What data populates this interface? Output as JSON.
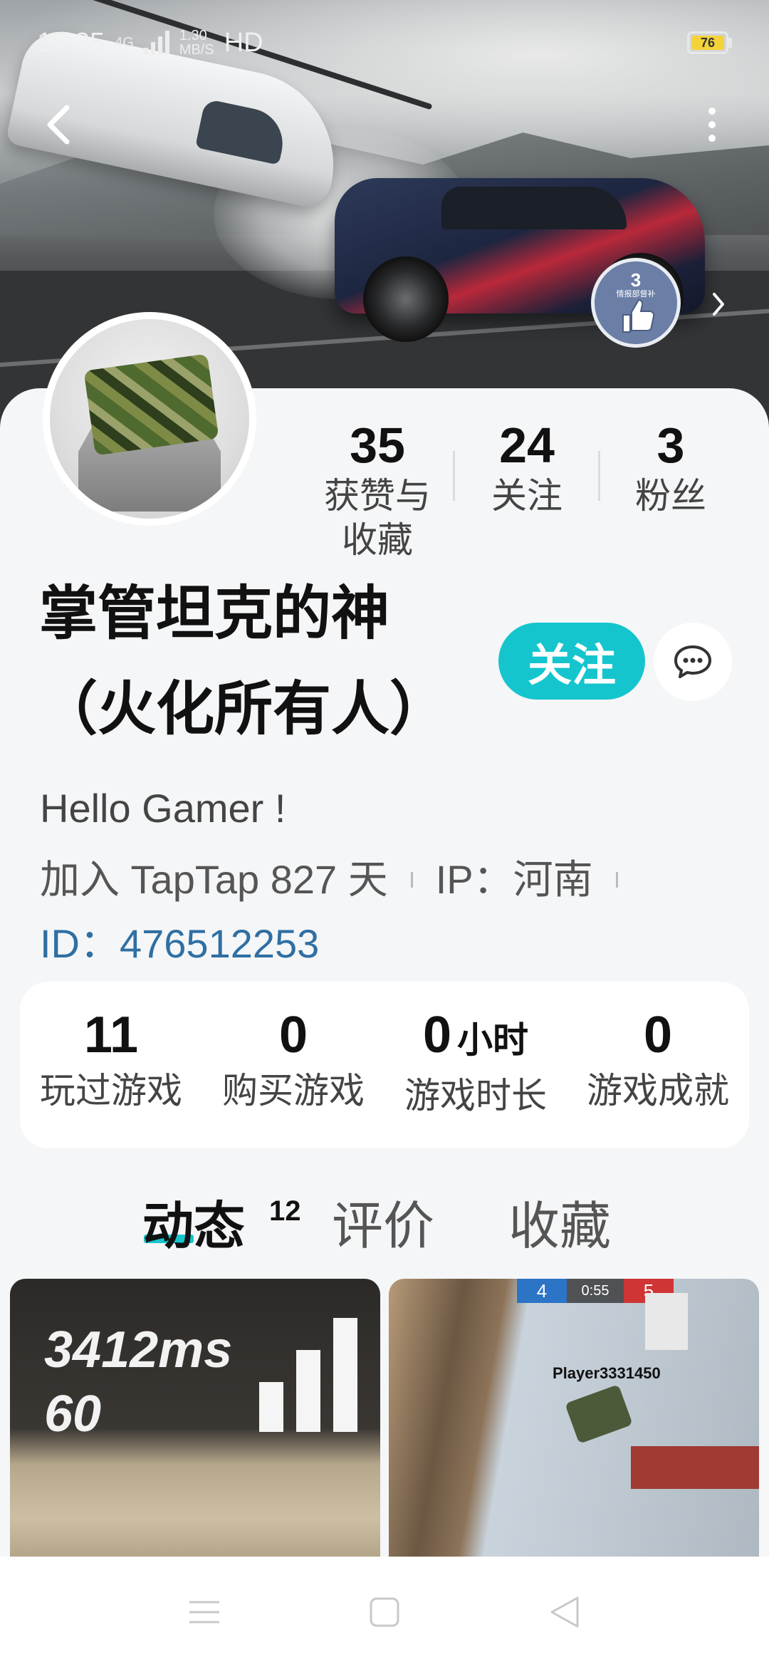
{
  "status_bar": {
    "time": "15:25",
    "network": "4G",
    "speed_value": "1.30",
    "speed_unit": "MB/S",
    "hd": "HD",
    "battery": "76"
  },
  "header": {
    "back_icon": "chevron-left-icon",
    "more_icon": "more-vertical-icon",
    "badge_count": "3",
    "badge_label": "情报部督补"
  },
  "profile": {
    "stats": [
      {
        "value": "35",
        "label": "获赞与收藏"
      },
      {
        "value": "24",
        "label": "关注"
      },
      {
        "value": "3",
        "label": "粉丝"
      }
    ],
    "username": "掌管坦克的神（火化所有人）",
    "follow_label": "关注",
    "message_icon": "chat-bubble-icon",
    "bio": "Hello Gamer !",
    "join_text": "加入 TapTap 827 天",
    "ip_text": "IP：河南",
    "id_text": "ID：476512253"
  },
  "game_stats": [
    {
      "value": "11",
      "unit": "",
      "label": "玩过游戏"
    },
    {
      "value": "0",
      "unit": "",
      "label": "购买游戏"
    },
    {
      "value": "0",
      "unit": "小时",
      "label": "游戏时长"
    },
    {
      "value": "0",
      "unit": "",
      "label": "游戏成就"
    }
  ],
  "tabs": [
    {
      "label": "动态",
      "count": "12",
      "active": true
    },
    {
      "label": "评价",
      "active": false
    },
    {
      "label": "收藏",
      "active": false
    }
  ],
  "posts": [
    {
      "ping": "3412ms",
      "fps": "60"
    },
    {
      "blue_score": "4",
      "time": "0:55",
      "red_score": "5",
      "player": "Player3331450"
    }
  ],
  "colors": {
    "accent": "#15c5ce",
    "id_blue": "#2f6fa3",
    "battery": "#f4d33a"
  }
}
